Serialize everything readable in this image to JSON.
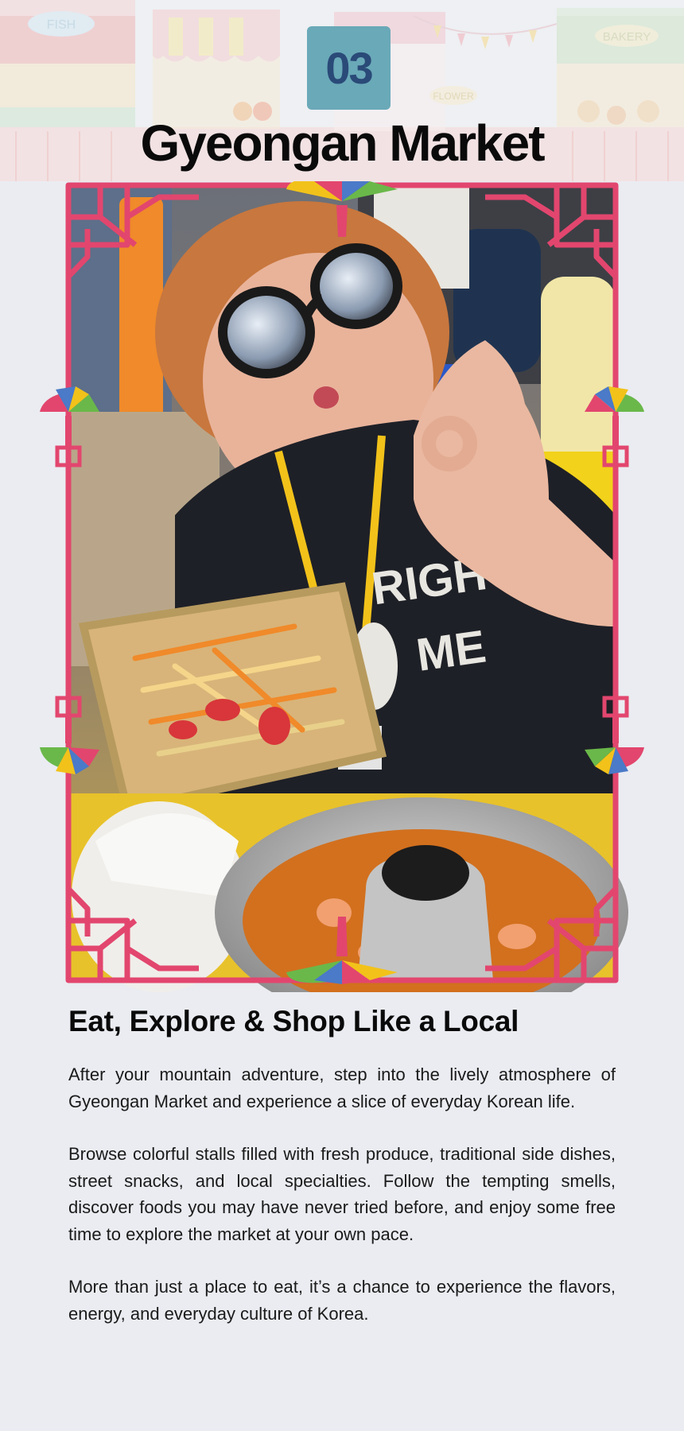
{
  "step_number": "03",
  "page_title": "Gyeongan Market",
  "header_stall_signs": [
    "FISH",
    "BAKERY",
    "FLOWER"
  ],
  "colors": {
    "background": "#eaecf1",
    "badge": "#6aa9b8",
    "badge_text": "#2a4a78",
    "frame_pink": "#e2466e"
  },
  "photo": {
    "shirt_text_line1": "RIGHT",
    "shirt_text_line2": "ME"
  },
  "section": {
    "heading": "Eat, Explore & Shop Like a Local",
    "paragraphs": [
      "After your mountain adventure, step into the lively atmosphere of Gyeongan Market and experience a slice of everyday Korean life.",
      "Browse colorful stalls filled with fresh produce, traditional side dishes, street snacks, and local specialties. Follow the tempting smells, discover foods you may have never tried before, and enjoy some free time to explore the market at your own pace.",
      "More than just a place to eat, it’s a chance to experience the flavors, energy, and everyday culture of Korea."
    ]
  }
}
